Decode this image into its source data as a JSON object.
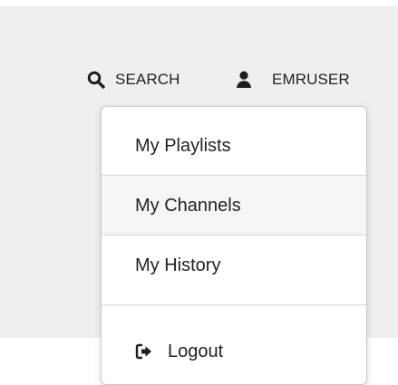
{
  "header": {
    "search_label": "SEARCH",
    "user_label": "EMRUSER",
    "search_icon": "search-icon",
    "user_icon": "user-icon"
  },
  "dropdown": {
    "items": [
      {
        "label": "My Playlists"
      },
      {
        "label": "My Channels"
      },
      {
        "label": "My History"
      }
    ],
    "logout": {
      "label": "Logout",
      "icon": "sign-out-icon"
    }
  },
  "colors": {
    "background": "#ffffff",
    "header_background": "#efefef",
    "text": "#222222",
    "menu_border": "#c9c9c9",
    "highlight": "#f5f5f5",
    "divider": "#d8d8d8"
  }
}
